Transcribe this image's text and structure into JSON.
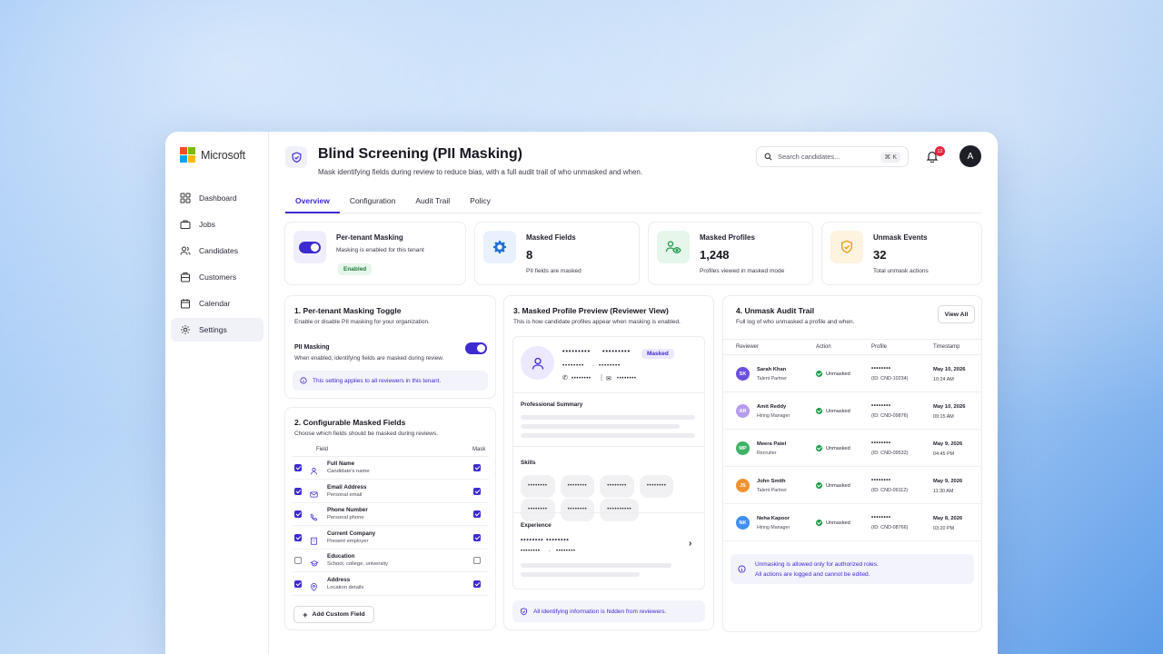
{
  "brand": {
    "name": "Microsoft",
    "logo_colors": [
      "#f25022",
      "#7fba00",
      "#00a4ef",
      "#ffb900"
    ]
  },
  "sidebar": {
    "items": [
      {
        "label": "Dashboard",
        "icon": "grid-icon"
      },
      {
        "label": "Jobs",
        "icon": "briefcase-icon"
      },
      {
        "label": "Candidates",
        "icon": "users-icon"
      },
      {
        "label": "Customers",
        "icon": "building-icon"
      },
      {
        "label": "Calendar",
        "icon": "calendar-icon"
      },
      {
        "label": "Settings",
        "icon": "gear-icon",
        "active": true
      }
    ]
  },
  "header": {
    "title": "Blind Screening (PII Masking)",
    "subtitle": "Mask identifying fields during review to reduce bias, with a full audit trail of who unmasked and when.",
    "search_placeholder": "Search candidates...",
    "search_shortcut": "⌘ K",
    "notification_count": "12",
    "avatar_initial": "A"
  },
  "tabs": [
    {
      "label": "Overview",
      "active": true
    },
    {
      "label": "Configuration"
    },
    {
      "label": "Audit Trail"
    },
    {
      "label": "Policy"
    }
  ],
  "stats": {
    "tenant": {
      "title": "Per-tenant Masking",
      "subtitle": "Masking is enabled for this tenant",
      "badge": "Enabled"
    },
    "fields": {
      "title": "Masked Fields",
      "value": "8",
      "subtitle": "PII fields are masked"
    },
    "profiles": {
      "title": "Masked Profiles",
      "value": "1,248",
      "subtitle": "Profiles viewed in masked mode"
    },
    "events": {
      "title": "Unmask Events",
      "value": "32",
      "subtitle": "Total unmask actions"
    }
  },
  "toggle_section": {
    "title": "1. Per-tenant Masking Toggle",
    "subtitle": "Enable or disable PII masking for your organization.",
    "label": "PII Masking",
    "description": "When enabled, identifying fields are masked during review.",
    "info": "This setting applies to all reviewers in this tenant."
  },
  "fields_section": {
    "title": "2. Configurable Masked Fields",
    "subtitle": "Choose which fields should be masked during reviews.",
    "col_field": "Field",
    "col_mask": "Mask",
    "fields": [
      {
        "name": "Full Name",
        "desc": "Candidate's name",
        "icon": "user-icon",
        "checked": true
      },
      {
        "name": "Email Address",
        "desc": "Personal email",
        "icon": "mail-icon",
        "checked": true
      },
      {
        "name": "Phone Number",
        "desc": "Personal phone",
        "icon": "phone-icon",
        "checked": true
      },
      {
        "name": "Current Company",
        "desc": "Present employer",
        "icon": "building-icon",
        "checked": true
      },
      {
        "name": "Education",
        "desc": "School, college, university",
        "icon": "graduation-cap-icon",
        "checked": false
      },
      {
        "name": "Address",
        "desc": "Location details",
        "icon": "location-pin-icon",
        "checked": true
      }
    ],
    "add_button": "Add Custom Field"
  },
  "preview_section": {
    "title": "3. Masked Profile Preview (Reviewer View)",
    "subtitle": "This is how candidate profiles appear when masking is enabled.",
    "name_mask_1": "•••••••••",
    "name_mask_2": "•••••••••",
    "masked_badge": "Masked",
    "line_mask_1": "••••••••",
    "line_mask_2": "••••••••",
    "phone_mask": "••••••••",
    "email_mask": "••••••••",
    "summary_label": "Professional Summary",
    "skills_label": "Skills",
    "skills": [
      "••••••••",
      "••••••••",
      "••••••••",
      "••••••••",
      "••••••••",
      "••••••••",
      "••••••••••"
    ],
    "experience_label": "Experience",
    "exp_mask_1": "•••••••• ••••••••",
    "exp_mask_2": "••••••••",
    "exp_mask_3": "••••••••",
    "footer": "All identifying information is hidden from reviewers."
  },
  "audit_section": {
    "title": "4. Unmask Audit Trail",
    "subtitle": "Full log of who unmasked a profile and when.",
    "view_all": "View All",
    "columns": [
      "Reviewer",
      "Action",
      "Profile",
      "Timestamp"
    ],
    "rows": [
      {
        "initials": "SK",
        "color": "#6b4fe0",
        "name": "Sarah Khan",
        "role": "Talent Partner",
        "action": "Unmasked",
        "profile": "••••••••",
        "id": "(ID: CND-10234)",
        "date": "May 10, 2026",
        "time": "10:24 AM"
      },
      {
        "initials": "AR",
        "color": "#b49cf0",
        "name": "Amit Reddy",
        "role": "Hiring Manager",
        "action": "Unmasked",
        "profile": "••••••••",
        "id": "(ID: CND-09876)",
        "date": "May 10, 2026",
        "time": "09:15 AM"
      },
      {
        "initials": "MP",
        "color": "#3fb26a",
        "name": "Meera Patel",
        "role": "Recruiter",
        "action": "Unmasked",
        "profile": "••••••••",
        "id": "(ID: CND-09532)",
        "date": "May 9, 2026",
        "time": "04:45 PM"
      },
      {
        "initials": "JS",
        "color": "#f0922f",
        "name": "John Smith",
        "role": "Talent Partner",
        "action": "Unmasked",
        "profile": "••••••••",
        "id": "(ID: CND-09112)",
        "date": "May 9, 2026",
        "time": "11:30 AM"
      },
      {
        "initials": "NK",
        "color": "#3f8ff0",
        "name": "Neha Kapoor",
        "role": "Hiring Manager",
        "action": "Unmasked",
        "profile": "••••••••",
        "id": "(ID: CND-08766)",
        "date": "May 8, 2026",
        "time": "03:20 PM"
      }
    ],
    "note_1": "Unmasking is allowed only for authorized roles.",
    "note_2": "All actions are logged and cannot be edited."
  },
  "colors": {
    "accent": "#3d2bd1",
    "success": "#1f9a4a",
    "danger": "#e3233b"
  }
}
